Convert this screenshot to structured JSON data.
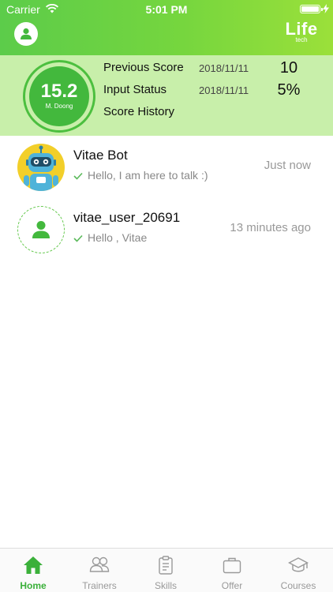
{
  "status_bar": {
    "carrier": "Carrier",
    "time": "5:01 PM"
  },
  "header": {
    "logo_main": "Life",
    "logo_sub": "tech"
  },
  "score": {
    "value": "15.2",
    "name": "M. Doong",
    "rows": [
      {
        "label": "Previous Score",
        "date": "2018/11/11",
        "value": "10"
      },
      {
        "label": "Input Status",
        "date": "2018/11/11",
        "value": "5%"
      },
      {
        "label": "Score History"
      }
    ]
  },
  "chats": [
    {
      "name": "Vitae Bot",
      "message": "Hello, I am here to talk :)",
      "time": "Just now"
    },
    {
      "name": "vitae_user_20691",
      "message": "Hello , Vitae",
      "time": "13 minutes ago"
    }
  ],
  "tabs": [
    {
      "label": "Home",
      "icon": "home-icon",
      "active": true
    },
    {
      "label": "Trainers",
      "icon": "people-icon"
    },
    {
      "label": "Skills",
      "icon": "clipboard-icon"
    },
    {
      "label": "Offer",
      "icon": "briefcase-icon"
    },
    {
      "label": "Courses",
      "icon": "graduation-cap-icon"
    }
  ],
  "colors": {
    "header_start": "#5ccc4a",
    "header_end": "#9be03a",
    "panel_bg": "#c8efaa",
    "accent": "#43b83d",
    "tab_active": "#3bb03a"
  }
}
